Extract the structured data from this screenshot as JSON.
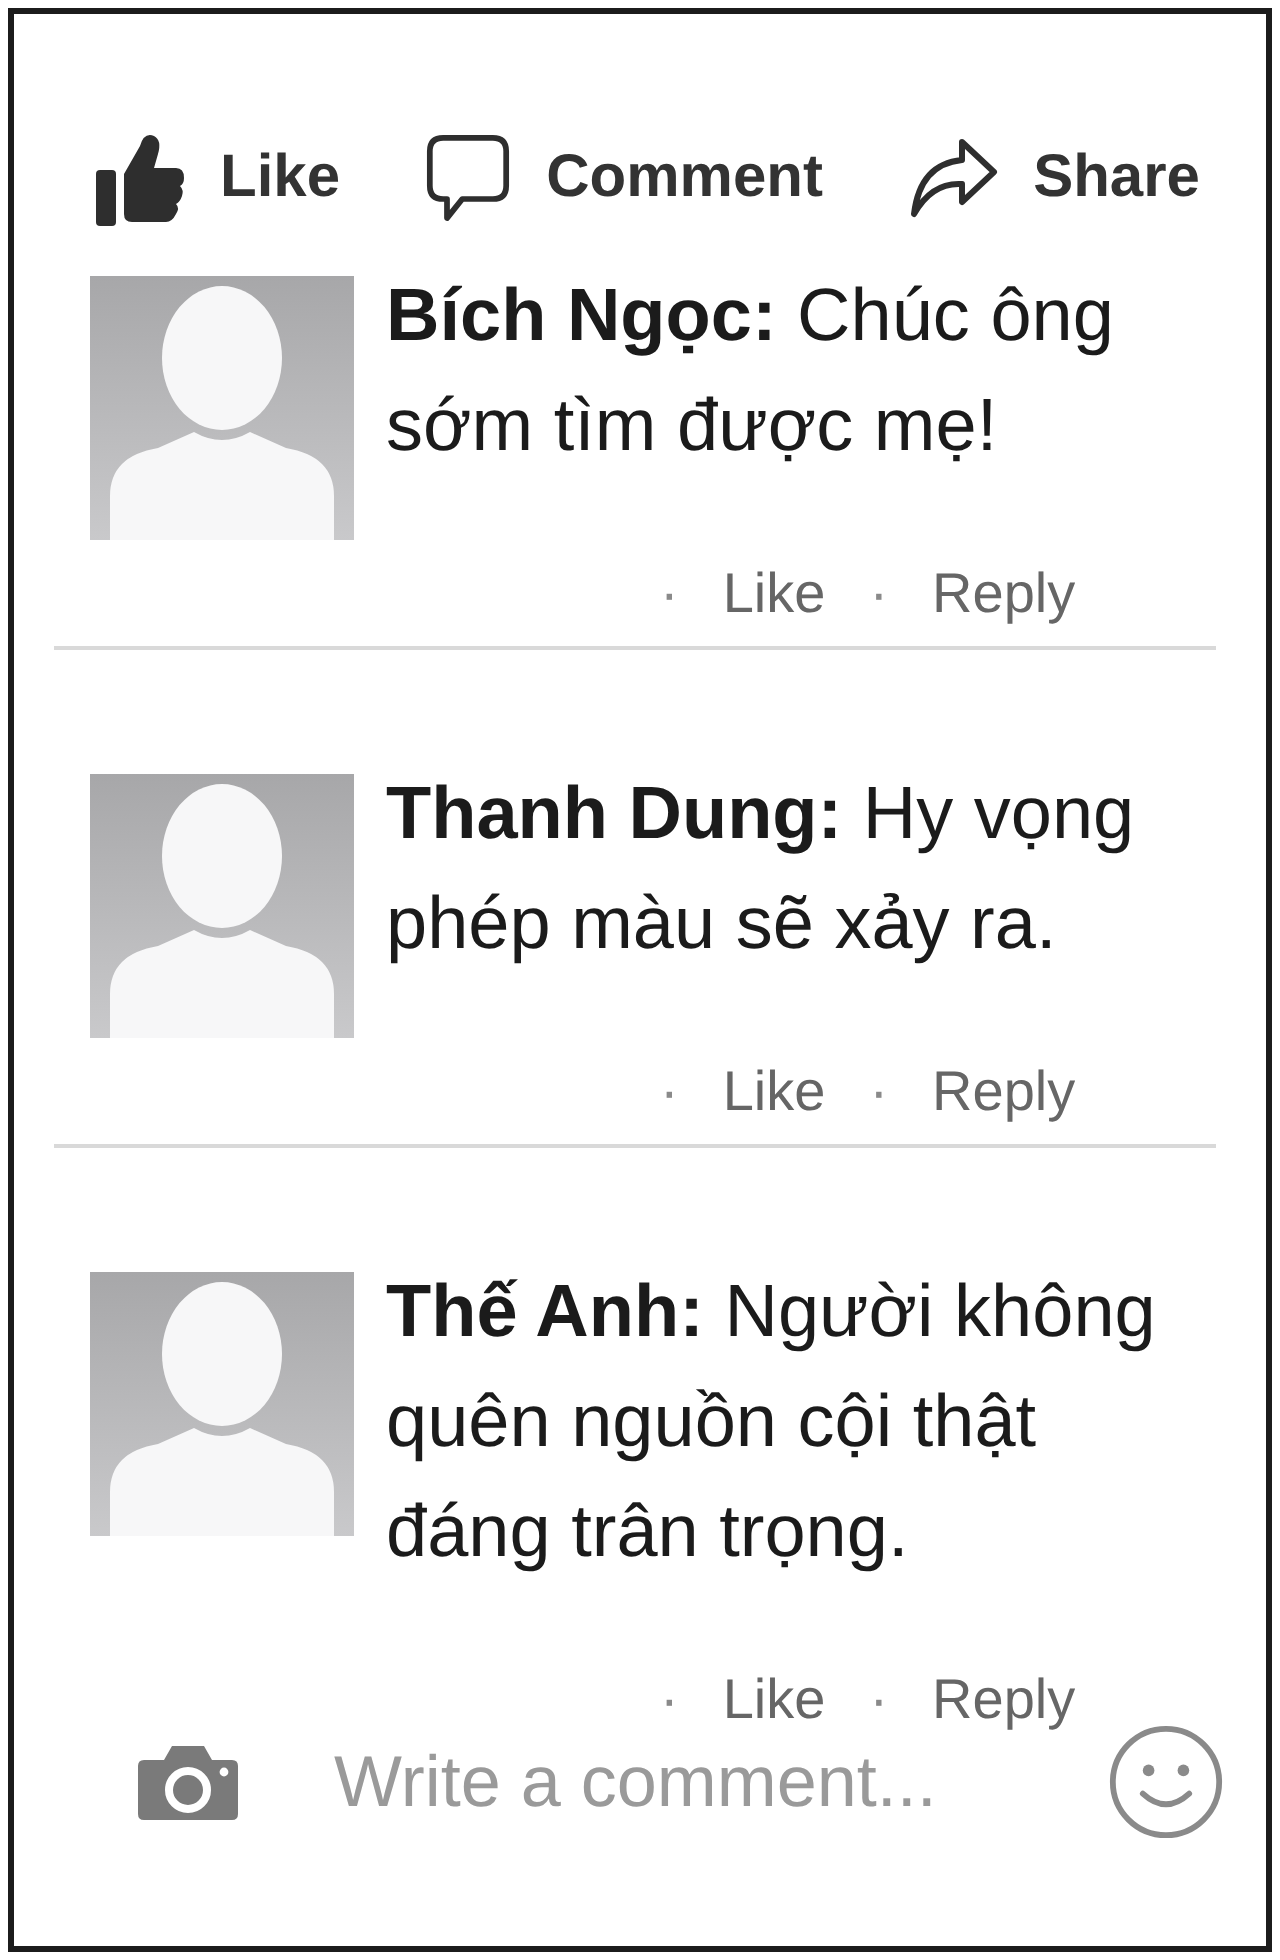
{
  "actions": [
    {
      "kind": "like",
      "label": "Like"
    },
    {
      "kind": "comment",
      "label": "Comment"
    },
    {
      "kind": "share",
      "label": "Share"
    }
  ],
  "comments": [
    {
      "text": "**Bích Ngọc:** Chúc ông sớm tìm được mẹ!",
      "actions": [
        {
          "separator": "·",
          "label": "Like"
        },
        {
          "separator": "·",
          "label": "Reply"
        }
      ]
    },
    {
      "text": "**Thanh Dung:** Hy vọng phép màu sẽ xảy ra.",
      "actions": [
        {
          "separator": "·",
          "label": "Like"
        },
        {
          "separator": "·",
          "label": "Reply"
        }
      ]
    },
    {
      "text": "**Thế Anh:** Người không quên nguồn cội thật đáng trân trọng.",
      "actions": [
        {
          "separator": "·",
          "label": "Like"
        },
        {
          "separator": "·",
          "label": "Reply"
        }
      ]
    }
  ],
  "composer": {
    "placeholder": "Write a comment..."
  }
}
